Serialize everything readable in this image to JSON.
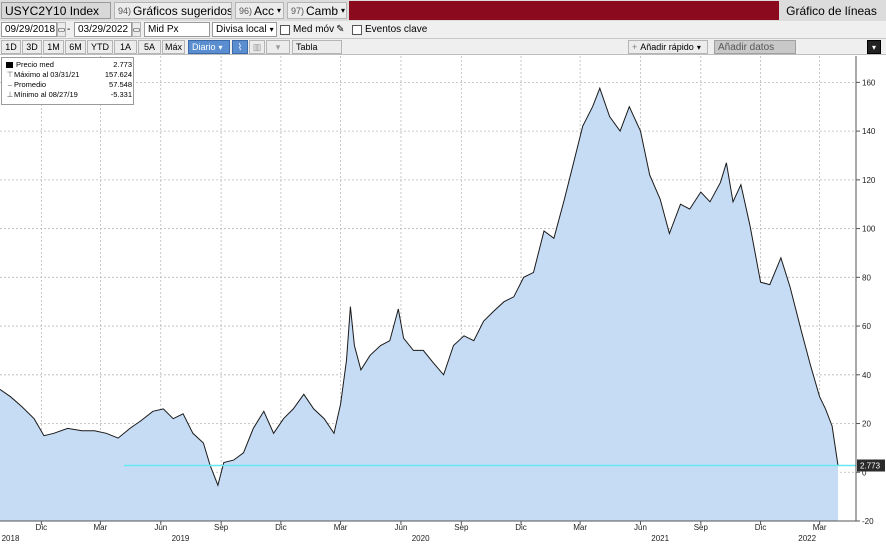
{
  "toolbar": {
    "ticker": "USYC2Y10 Index",
    "suggested_num": "94)",
    "suggested_label": "Gráficos sugeridos",
    "actions_num": "96)",
    "actions_label": "Acc",
    "change_num": "97)",
    "change_label": "Camb",
    "chart_type_label": "Gráfico de líneas"
  },
  "controls": {
    "start_date": "09/29/2018",
    "end_date": "03/29/2022",
    "price_field": "Mid Px",
    "currency": "Divisa local",
    "moving_avg_label": "Med móv",
    "key_events_label": "Eventos clave"
  },
  "periods": [
    "1D",
    "3D",
    "1M",
    "6M",
    "YTD",
    "1A",
    "5A",
    "Máx"
  ],
  "frequency": "Diario",
  "table_label": "Tabla",
  "quick_add_label": "Añadir rápido",
  "add_data_label": "Añadir datos",
  "legend": {
    "last_label": "Precio med",
    "last_value": "2.773",
    "max_label": "Máximo al 03/31/21",
    "max_value": "157.624",
    "avg_label": "Promedio",
    "avg_value": "57.548",
    "min_label": "Mínimo al 08/27/19",
    "min_value": "-5.331"
  },
  "colors": {
    "line": "#1a1a1a",
    "area": "#c6dcf4",
    "last_price_line": "#66e8f2",
    "last_price_tag": "#2b2b2b",
    "toolbar_red": "#8b0a1e",
    "selected_button": "#5a8ed0"
  },
  "chart_data": {
    "type": "area",
    "title": "",
    "xlabel": "",
    "ylabel": "",
    "ylim": [
      -20,
      170
    ],
    "xlim": [
      "2018-09-29",
      "2022-03-29"
    ],
    "y_ticks": [
      -20,
      0,
      20,
      40,
      60,
      80,
      100,
      120,
      140,
      160
    ],
    "y_axis_side": "right",
    "grid": true,
    "legend_position": "top-left",
    "month_ticks": [
      {
        "date": "2018-12-01",
        "label": "Dic"
      },
      {
        "date": "2019-03-01",
        "label": "Mar"
      },
      {
        "date": "2019-06-01",
        "label": "Jun"
      },
      {
        "date": "2019-09-01",
        "label": "Sep"
      },
      {
        "date": "2019-12-01",
        "label": "Dic"
      },
      {
        "date": "2020-03-01",
        "label": "Mar"
      },
      {
        "date": "2020-06-01",
        "label": "Jun"
      },
      {
        "date": "2020-09-01",
        "label": "Sep"
      },
      {
        "date": "2020-12-01",
        "label": "Dic"
      },
      {
        "date": "2021-03-01",
        "label": "Mar"
      },
      {
        "date": "2021-06-01",
        "label": "Jun"
      },
      {
        "date": "2021-09-01",
        "label": "Sep"
      },
      {
        "date": "2021-12-01",
        "label": "Dic"
      },
      {
        "date": "2022-03-01",
        "label": "Mar"
      }
    ],
    "year_ticks": [
      {
        "date": "2018-10-15",
        "label": "2018"
      },
      {
        "date": "2019-07-01",
        "label": "2019"
      },
      {
        "date": "2020-07-01",
        "label": "2020"
      },
      {
        "date": "2021-07-01",
        "label": "2021"
      },
      {
        "date": "2022-02-10",
        "label": "2022"
      }
    ],
    "last_value": 2.773,
    "last_value_label": "2.773",
    "series": [
      {
        "values": [
          {
            "date": "2018-09-29",
            "y": 34
          },
          {
            "date": "2018-10-15",
            "y": 31
          },
          {
            "date": "2018-11-01",
            "y": 27
          },
          {
            "date": "2018-11-20",
            "y": 22
          },
          {
            "date": "2018-12-05",
            "y": 15
          },
          {
            "date": "2018-12-20",
            "y": 16
          },
          {
            "date": "2019-01-10",
            "y": 18
          },
          {
            "date": "2019-02-01",
            "y": 17
          },
          {
            "date": "2019-02-20",
            "y": 17
          },
          {
            "date": "2019-03-10",
            "y": 16
          },
          {
            "date": "2019-03-28",
            "y": 14
          },
          {
            "date": "2019-04-15",
            "y": 18
          },
          {
            "date": "2019-05-01",
            "y": 21
          },
          {
            "date": "2019-05-20",
            "y": 25
          },
          {
            "date": "2019-06-05",
            "y": 26
          },
          {
            "date": "2019-06-20",
            "y": 22
          },
          {
            "date": "2019-07-05",
            "y": 24
          },
          {
            "date": "2019-07-20",
            "y": 16
          },
          {
            "date": "2019-08-05",
            "y": 12
          },
          {
            "date": "2019-08-15",
            "y": 3
          },
          {
            "date": "2019-08-27",
            "y": -5.3
          },
          {
            "date": "2019-09-05",
            "y": 4
          },
          {
            "date": "2019-09-20",
            "y": 5
          },
          {
            "date": "2019-10-05",
            "y": 8
          },
          {
            "date": "2019-10-20",
            "y": 18
          },
          {
            "date": "2019-11-05",
            "y": 25
          },
          {
            "date": "2019-11-20",
            "y": 16
          },
          {
            "date": "2019-12-05",
            "y": 22
          },
          {
            "date": "2019-12-20",
            "y": 26
          },
          {
            "date": "2020-01-05",
            "y": 32
          },
          {
            "date": "2020-01-20",
            "y": 26
          },
          {
            "date": "2020-02-05",
            "y": 22
          },
          {
            "date": "2020-02-20",
            "y": 16
          },
          {
            "date": "2020-03-01",
            "y": 28
          },
          {
            "date": "2020-03-10",
            "y": 46
          },
          {
            "date": "2020-03-16",
            "y": 68
          },
          {
            "date": "2020-03-22",
            "y": 52
          },
          {
            "date": "2020-04-01",
            "y": 42
          },
          {
            "date": "2020-04-15",
            "y": 48
          },
          {
            "date": "2020-05-01",
            "y": 52
          },
          {
            "date": "2020-05-15",
            "y": 54
          },
          {
            "date": "2020-05-28",
            "y": 67
          },
          {
            "date": "2020-06-05",
            "y": 55
          },
          {
            "date": "2020-06-20",
            "y": 50
          },
          {
            "date": "2020-07-05",
            "y": 50
          },
          {
            "date": "2020-07-20",
            "y": 45
          },
          {
            "date": "2020-08-05",
            "y": 40
          },
          {
            "date": "2020-08-20",
            "y": 52
          },
          {
            "date": "2020-09-05",
            "y": 56
          },
          {
            "date": "2020-09-20",
            "y": 54
          },
          {
            "date": "2020-10-05",
            "y": 62
          },
          {
            "date": "2020-10-20",
            "y": 66
          },
          {
            "date": "2020-11-05",
            "y": 70
          },
          {
            "date": "2020-11-20",
            "y": 72
          },
          {
            "date": "2020-12-05",
            "y": 80
          },
          {
            "date": "2020-12-20",
            "y": 82
          },
          {
            "date": "2021-01-05",
            "y": 99
          },
          {
            "date": "2021-01-20",
            "y": 96
          },
          {
            "date": "2021-02-05",
            "y": 112
          },
          {
            "date": "2021-02-20",
            "y": 128
          },
          {
            "date": "2021-03-05",
            "y": 142
          },
          {
            "date": "2021-03-20",
            "y": 150
          },
          {
            "date": "2021-03-31",
            "y": 157.6
          },
          {
            "date": "2021-04-15",
            "y": 146
          },
          {
            "date": "2021-05-01",
            "y": 140
          },
          {
            "date": "2021-05-15",
            "y": 150
          },
          {
            "date": "2021-06-01",
            "y": 140
          },
          {
            "date": "2021-06-15",
            "y": 122
          },
          {
            "date": "2021-07-01",
            "y": 112
          },
          {
            "date": "2021-07-15",
            "y": 98
          },
          {
            "date": "2021-08-01",
            "y": 110
          },
          {
            "date": "2021-08-15",
            "y": 108
          },
          {
            "date": "2021-09-01",
            "y": 115
          },
          {
            "date": "2021-09-15",
            "y": 111
          },
          {
            "date": "2021-10-01",
            "y": 119
          },
          {
            "date": "2021-10-10",
            "y": 127
          },
          {
            "date": "2021-10-20",
            "y": 111
          },
          {
            "date": "2021-11-01",
            "y": 118
          },
          {
            "date": "2021-11-15",
            "y": 101
          },
          {
            "date": "2021-12-01",
            "y": 78
          },
          {
            "date": "2021-12-15",
            "y": 77
          },
          {
            "date": "2022-01-01",
            "y": 88
          },
          {
            "date": "2022-01-15",
            "y": 76
          },
          {
            "date": "2022-02-01",
            "y": 58
          },
          {
            "date": "2022-02-15",
            "y": 44
          },
          {
            "date": "2022-03-01",
            "y": 31
          },
          {
            "date": "2022-03-10",
            "y": 26
          },
          {
            "date": "2022-03-20",
            "y": 19
          },
          {
            "date": "2022-03-29",
            "y": 2.773
          }
        ]
      }
    ]
  }
}
